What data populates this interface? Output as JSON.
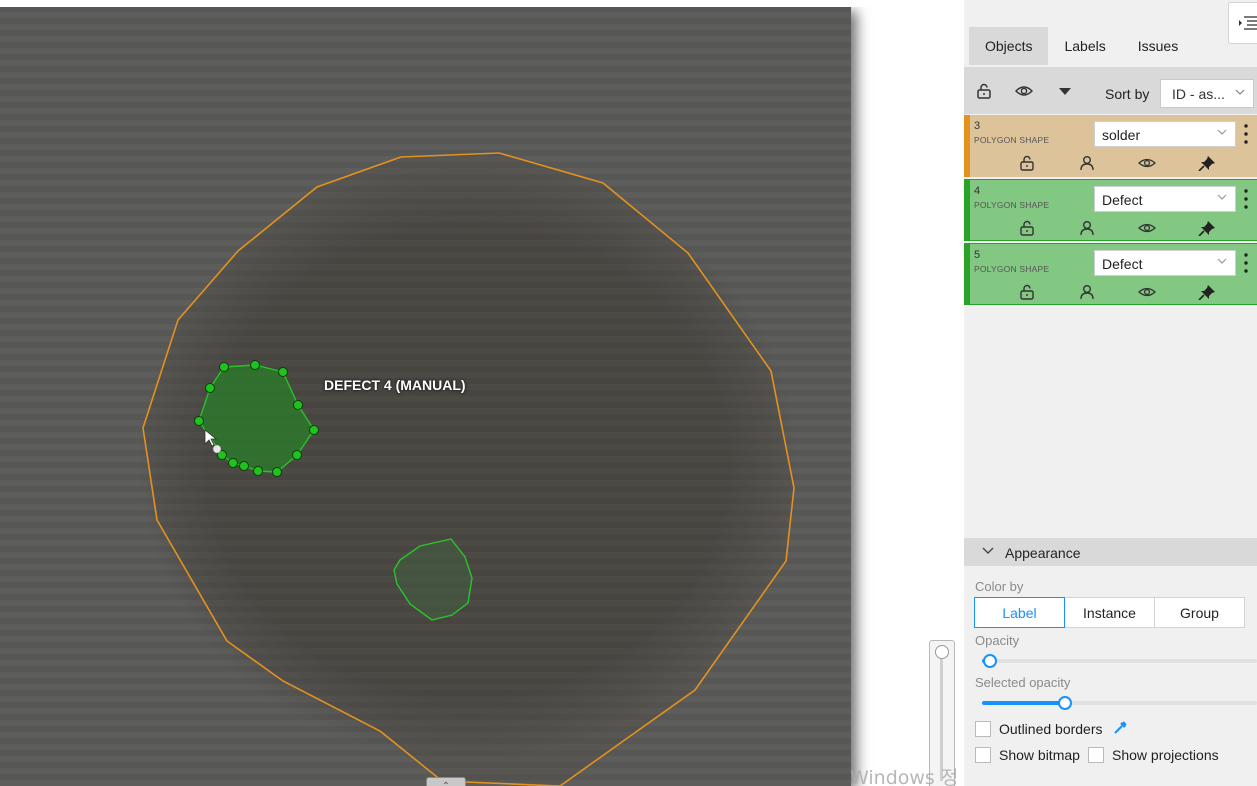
{
  "canvas": {
    "annotation_label": "DEFECT 4 (MANUAL)",
    "watermark": "Windows 정품 인증",
    "colors": {
      "solder_outline": "#e3921e",
      "defect_fill": "#2a8a2a",
      "defect_point": "#1fc21f"
    }
  },
  "sidebar": {
    "tabs": [
      "Objects",
      "Labels",
      "Issues"
    ],
    "active_tab": "Objects",
    "toolbar": {
      "lock_icon": "lock-open-icon",
      "visibility_icon": "eye-icon",
      "collapse_icon": "caret-down-icon",
      "sort_label": "Sort by",
      "sort_value": "ID - as..."
    },
    "objects": [
      {
        "id": "3",
        "type": "POLYGON SHAPE",
        "label": "solder",
        "color": "#e3921e",
        "bg": "#dcc39a"
      },
      {
        "id": "4",
        "type": "POLYGON SHAPE",
        "label": "Defect",
        "color": "#27a327",
        "bg": "#82c782"
      },
      {
        "id": "5",
        "type": "POLYGON SHAPE",
        "label": "Defect",
        "color": "#27a327",
        "bg": "#82c782"
      }
    ],
    "appearance": {
      "title": "Appearance",
      "color_by_label": "Color by",
      "color_by_options": [
        "Label",
        "Instance",
        "Group"
      ],
      "color_by_selected": "Label",
      "opacity_label": "Opacity",
      "opacity_value": 0.03,
      "selected_opacity_label": "Selected opacity",
      "selected_opacity_value": 0.3,
      "outlined_borders_label": "Outlined borders",
      "show_bitmap_label": "Show bitmap",
      "show_projections_label": "Show projections"
    }
  }
}
